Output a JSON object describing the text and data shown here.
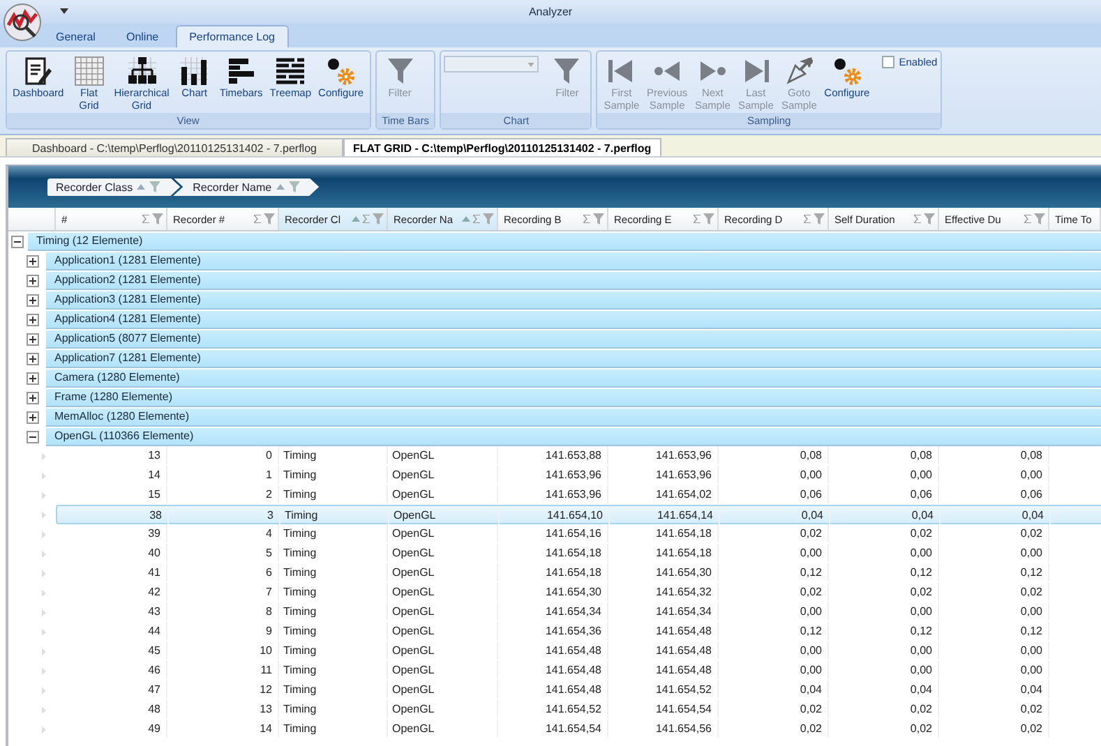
{
  "window": {
    "title": "Analyzer"
  },
  "ribbon_tabs": [
    {
      "label": "General",
      "selected": false
    },
    {
      "label": "Online",
      "selected": false
    },
    {
      "label": "Performance Log",
      "selected": true
    }
  ],
  "ribbon_groups": [
    {
      "label": "View",
      "buttons": [
        {
          "label": "Dashboard",
          "kind": "dashboard",
          "disabled": false
        },
        {
          "label": "Flat\nGrid",
          "kind": "flatgrid",
          "disabled": false
        },
        {
          "label": "Hierarchical\nGrid",
          "kind": "hierarchical",
          "disabled": false
        },
        {
          "label": "Chart",
          "kind": "chart",
          "disabled": false
        },
        {
          "label": "Timebars",
          "kind": "timebars",
          "disabled": false
        },
        {
          "label": "Treemap",
          "kind": "treemap",
          "disabled": false
        },
        {
          "label": "Configure",
          "kind": "configure",
          "disabled": false
        }
      ]
    },
    {
      "label": "Time Bars",
      "buttons": [
        {
          "label": "Filter",
          "kind": "filter",
          "disabled": true
        }
      ]
    },
    {
      "label": "Chart",
      "combo_box": {
        "disabled": true
      },
      "buttons": [
        {
          "label": "Filter",
          "kind": "filter",
          "disabled": true
        }
      ]
    },
    {
      "label": "Sampling",
      "buttons": [
        {
          "label": "First\nSample",
          "kind": "first",
          "disabled": true
        },
        {
          "label": "Previous\nSample",
          "kind": "previous",
          "disabled": true
        },
        {
          "label": "Next\nSample",
          "kind": "next",
          "disabled": true
        },
        {
          "label": "Last\nSample",
          "kind": "last",
          "disabled": true
        },
        {
          "label": "Goto\nSample",
          "kind": "goto",
          "disabled": true
        },
        {
          "label": "Configure",
          "kind": "configure",
          "disabled": false
        }
      ],
      "checkbox": {
        "label": "Enabled",
        "checked": false
      }
    }
  ],
  "document_tabs": [
    {
      "label": "Dashboard - C:\\temp\\Perflog\\20110125131402 - 7.perflog",
      "selected": false
    },
    {
      "label": "FLAT GRID - C:\\temp\\Perflog\\20110125131402 - 7.perflog",
      "selected": true
    }
  ],
  "group_panel": {
    "chips": [
      "Recorder Class",
      "Recorder Name"
    ]
  },
  "columns": [
    {
      "label": "#",
      "grouped": false,
      "icons": true
    },
    {
      "label": "Recorder #",
      "grouped": false,
      "icons": true
    },
    {
      "label": "Recorder Cl",
      "grouped": true,
      "icons": true
    },
    {
      "label": "Recorder Na",
      "grouped": true,
      "icons": true
    },
    {
      "label": "Recording B",
      "grouped": false,
      "icons": true
    },
    {
      "label": "Recording E",
      "grouped": false,
      "icons": true
    },
    {
      "label": "Recording D",
      "grouped": false,
      "icons": true
    },
    {
      "label": "Self Duration",
      "grouped": false,
      "icons": true
    },
    {
      "label": "Effective Du",
      "grouped": false,
      "icons": true
    },
    {
      "label": "Time To",
      "grouped": false,
      "icons": false
    }
  ],
  "groups": [
    {
      "label": "Timing (12 Elemente)",
      "expanded": true,
      "children": [
        {
          "label": "Application1 (1281 Elemente)",
          "expanded": false
        },
        {
          "label": "Application2 (1281 Elemente)",
          "expanded": false
        },
        {
          "label": "Application3 (1281 Elemente)",
          "expanded": false
        },
        {
          "label": "Application4 (1281 Elemente)",
          "expanded": false
        },
        {
          "label": "Application5 (8077 Elemente)",
          "expanded": false
        },
        {
          "label": "Application7 (1281 Elemente)",
          "expanded": false
        },
        {
          "label": "Camera (1280 Elemente)",
          "expanded": false
        },
        {
          "label": "Frame (1280 Elemente)",
          "expanded": false
        },
        {
          "label": "MemAlloc (1280 Elemente)",
          "expanded": false
        },
        {
          "label": "OpenGL (110366 Elemente)",
          "expanded": true,
          "rows": [
            {
              "selected": false,
              "cells": [
                "13",
                "0",
                "Timing",
                "OpenGL",
                "141.653,88",
                "141.653,96",
                "0,08",
                "0,08",
                "0,08"
              ]
            },
            {
              "selected": false,
              "cells": [
                "14",
                "1",
                "Timing",
                "OpenGL",
                "141.653,96",
                "141.653,96",
                "0,00",
                "0,00",
                "0,00"
              ]
            },
            {
              "selected": false,
              "cells": [
                "15",
                "2",
                "Timing",
                "OpenGL",
                "141.653,96",
                "141.654,02",
                "0,06",
                "0,06",
                "0,06"
              ]
            },
            {
              "selected": true,
              "cells": [
                "38",
                "3",
                "Timing",
                "OpenGL",
                "141.654,10",
                "141.654,14",
                "0,04",
                "0,04",
                "0,04"
              ]
            },
            {
              "selected": false,
              "cells": [
                "39",
                "4",
                "Timing",
                "OpenGL",
                "141.654,16",
                "141.654,18",
                "0,02",
                "0,02",
                "0,02"
              ]
            },
            {
              "selected": false,
              "cells": [
                "40",
                "5",
                "Timing",
                "OpenGL",
                "141.654,18",
                "141.654,18",
                "0,00",
                "0,00",
                "0,00"
              ]
            },
            {
              "selected": false,
              "cells": [
                "41",
                "6",
                "Timing",
                "OpenGL",
                "141.654,18",
                "141.654,30",
                "0,12",
                "0,12",
                "0,12"
              ]
            },
            {
              "selected": false,
              "cells": [
                "42",
                "7",
                "Timing",
                "OpenGL",
                "141.654,30",
                "141.654,32",
                "0,02",
                "0,02",
                "0,02"
              ]
            },
            {
              "selected": false,
              "cells": [
                "43",
                "8",
                "Timing",
                "OpenGL",
                "141.654,34",
                "141.654,34",
                "0,00",
                "0,00",
                "0,00"
              ]
            },
            {
              "selected": false,
              "cells": [
                "44",
                "9",
                "Timing",
                "OpenGL",
                "141.654,36",
                "141.654,48",
                "0,12",
                "0,12",
                "0,12"
              ]
            },
            {
              "selected": false,
              "cells": [
                "45",
                "10",
                "Timing",
                "OpenGL",
                "141.654,48",
                "141.654,48",
                "0,00",
                "0,00",
                "0,00"
              ]
            },
            {
              "selected": false,
              "cells": [
                "46",
                "11",
                "Timing",
                "OpenGL",
                "141.654,48",
                "141.654,48",
                "0,00",
                "0,00",
                "0,00"
              ]
            },
            {
              "selected": false,
              "cells": [
                "47",
                "12",
                "Timing",
                "OpenGL",
                "141.654,48",
                "141.654,52",
                "0,04",
                "0,04",
                "0,04"
              ]
            },
            {
              "selected": false,
              "cells": [
                "48",
                "13",
                "Timing",
                "OpenGL",
                "141.654,52",
                "141.654,54",
                "0,02",
                "0,02",
                "0,02"
              ]
            },
            {
              "selected": false,
              "cells": [
                "49",
                "14",
                "Timing",
                "OpenGL",
                "141.654,54",
                "141.654,56",
                "0,02",
                "0,02",
                "0,02"
              ]
            }
          ]
        }
      ]
    }
  ]
}
